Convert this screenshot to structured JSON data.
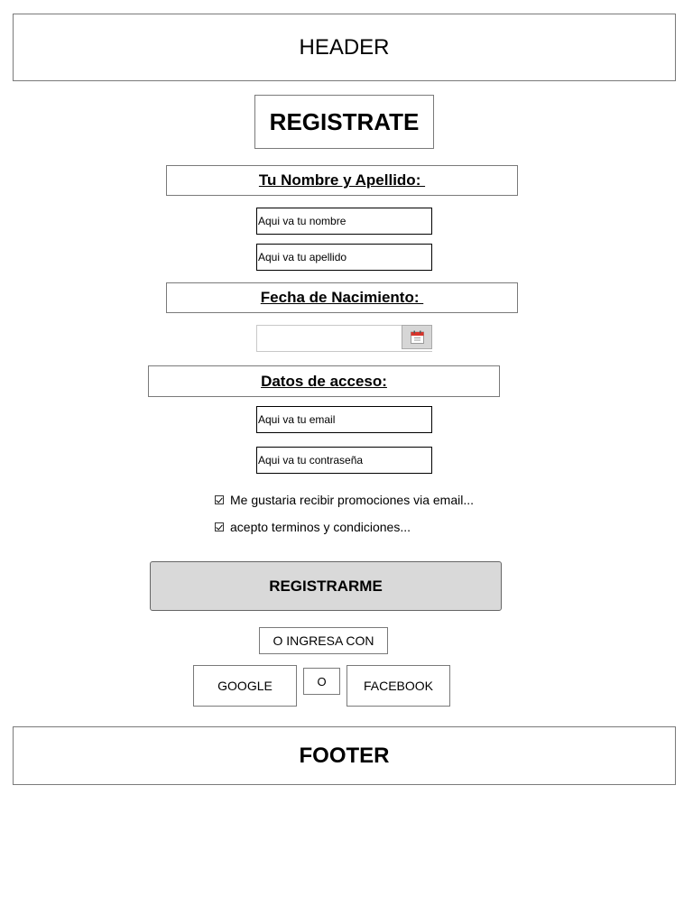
{
  "header": {
    "label": "HEADER"
  },
  "title": "REGISTRATE",
  "sections": {
    "name_label": "Tu Nombre y Apellido: ",
    "date_label": "Fecha de Nacimiento: ",
    "access_label": "Datos de acceso:"
  },
  "fields": {
    "first_name": {
      "placeholder": "Aqui va tu nombre",
      "value": ""
    },
    "last_name": {
      "placeholder": "Aqui va tu apellido",
      "value": ""
    },
    "birth_date": {
      "value": ""
    },
    "email": {
      "placeholder": "Aqui va tu email",
      "value": ""
    },
    "password": {
      "placeholder": "Aqui va tu contraseña",
      "value": ""
    }
  },
  "checkboxes": {
    "promo": {
      "label": "Me gustaria recibir promociones via email...",
      "checked": true
    },
    "terms": {
      "label": "acepto terminos y condiciones...",
      "checked": true
    }
  },
  "buttons": {
    "register": "REGISTRARME",
    "or_login_with": "O INGRESA CON",
    "google": "GOOGLE",
    "or": "O",
    "facebook": "FACEBOOK"
  },
  "icons": {
    "calendar": "calendar-icon",
    "calendar_color": "#d9342b"
  },
  "footer": {
    "label": "FOOTER"
  }
}
